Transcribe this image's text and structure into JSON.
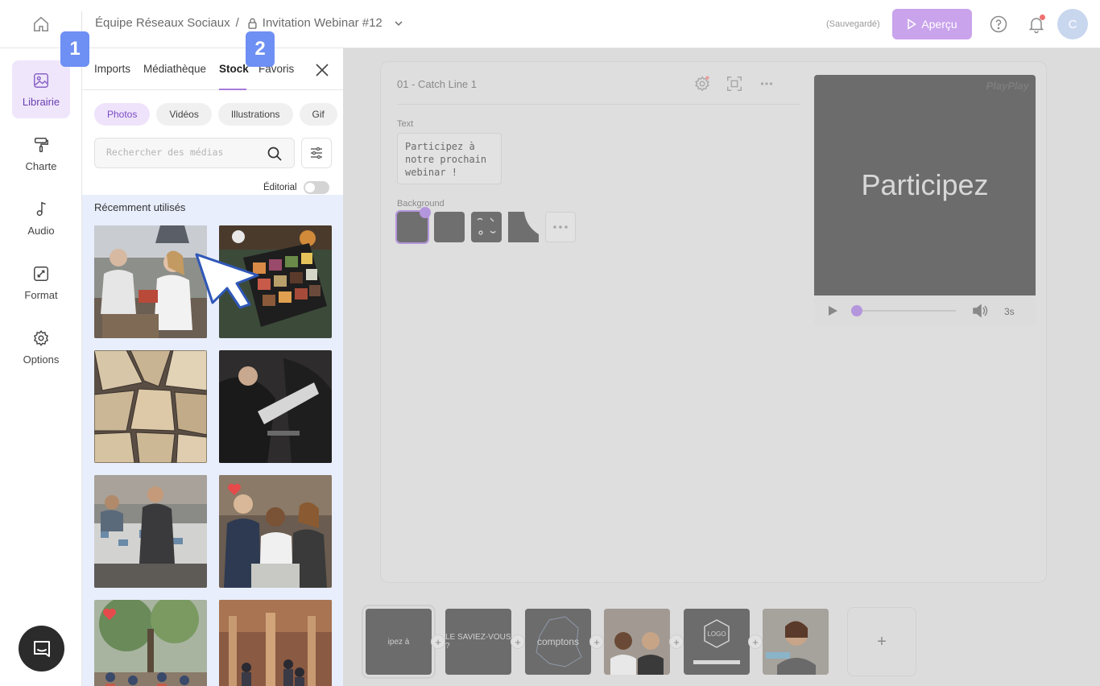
{
  "header": {
    "team": "Équipe Réseaux Sociaux",
    "separator": "/",
    "project": "Invitation Webinar #12",
    "saved_status": "(Sauvegardé)",
    "preview_label": "Aperçu",
    "avatar_initial": "C"
  },
  "sidebar": {
    "items": [
      {
        "label": "Librairie",
        "icon": "image-icon"
      },
      {
        "label": "Charte",
        "icon": "paint-roller-icon"
      },
      {
        "label": "Audio",
        "icon": "music-note-icon"
      },
      {
        "label": "Format",
        "icon": "resize-icon"
      },
      {
        "label": "Options",
        "icon": "gear-icon"
      }
    ]
  },
  "library": {
    "tabs": [
      "Imports",
      "Médiathèque",
      "Stock",
      "Favoris"
    ],
    "active_tab": "Stock",
    "chips": [
      "Photos",
      "Vidéos",
      "Illustrations",
      "Gif"
    ],
    "active_chip": "Photos",
    "search_placeholder": "Rechercher des médias",
    "editorial_label": "Éditorial",
    "section_title": "Récemment utilisés"
  },
  "badges": {
    "first": "1",
    "second": "2"
  },
  "editor": {
    "scene_title": "01 - Catch Line 1",
    "text_label": "Text",
    "text_value": "Participez à notre prochain webinar !",
    "background_label": "Background",
    "preview_watermark": "PlayPlay",
    "preview_text": "Participez",
    "duration": "3s"
  },
  "timeline": {
    "scenes": [
      {
        "text": "ipez à"
      },
      {
        "text": "LE SAVIEZ-VOUS ?"
      },
      {
        "text": "comptons"
      },
      {
        "text": ""
      },
      {
        "text": "LOGO"
      },
      {
        "text": ""
      }
    ],
    "add_label": "+"
  },
  "colors": {
    "accent": "#a77bdc",
    "preview_button": "#c9a3ec",
    "badge": "#6e8ff3",
    "active_nav_bg": "#efe6fb"
  }
}
